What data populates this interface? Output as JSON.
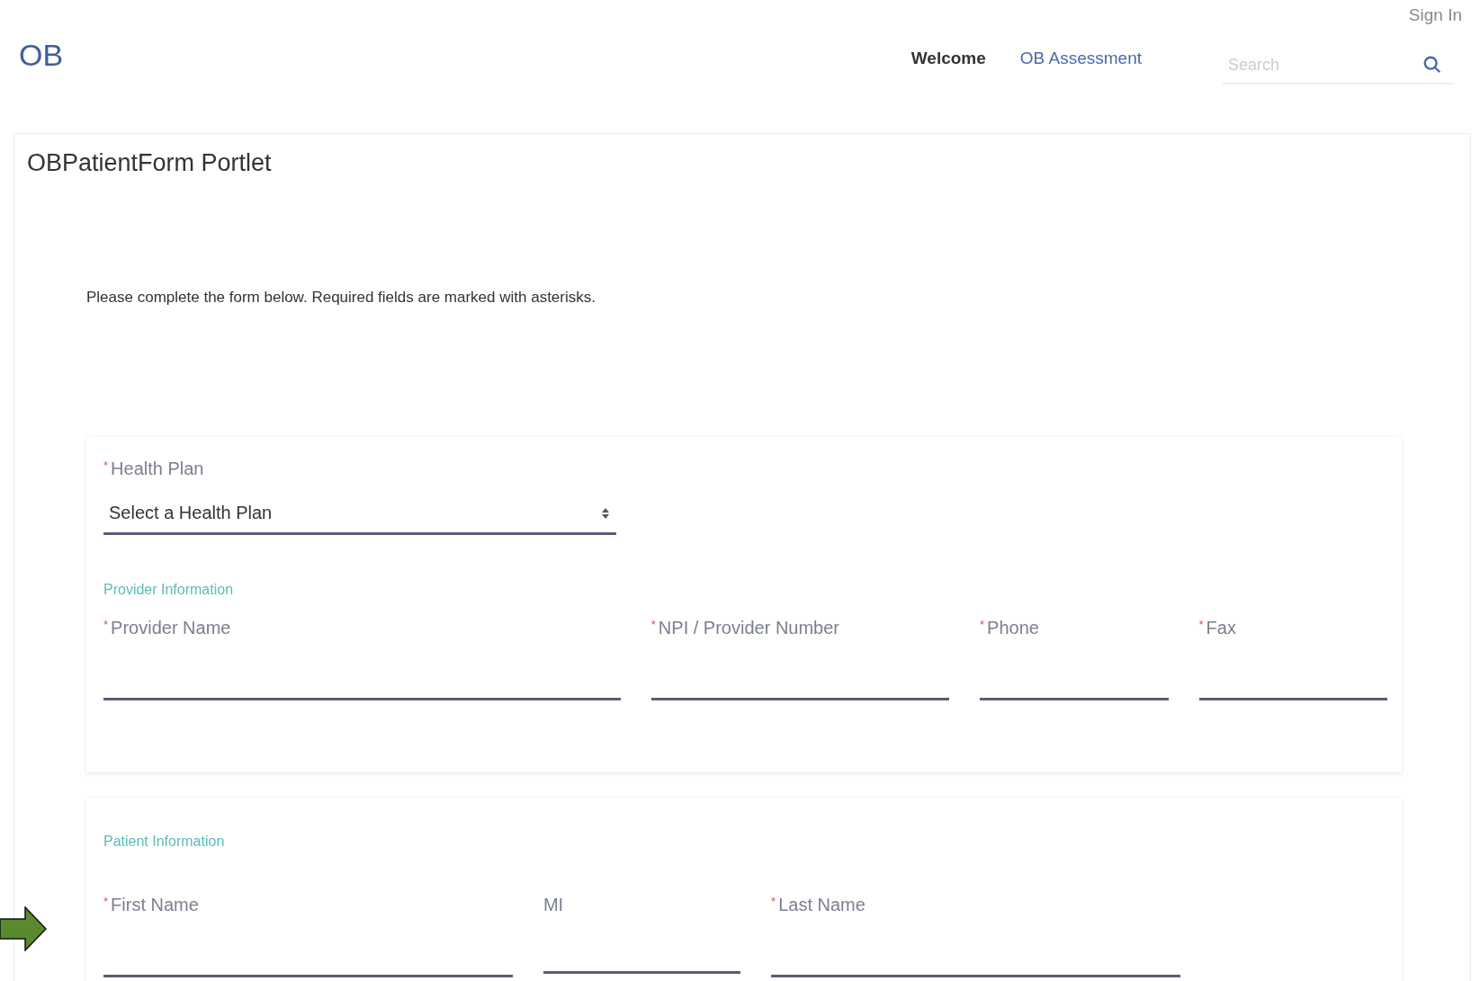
{
  "header": {
    "logo": "OB",
    "sign_in": "Sign In",
    "nav": [
      {
        "label": "Welcome",
        "selected": true
      },
      {
        "label": "OB Assessment",
        "selected": false
      }
    ],
    "search": {
      "placeholder": "Search"
    }
  },
  "portlet": {
    "title": "OBPatientForm Portlet",
    "intro": "Please complete the form below. Required fields are marked with asterisks.",
    "health_plan": {
      "mark": "*",
      "label": "Health Plan",
      "value": "Select a Health Plan"
    },
    "sections": [
      {
        "title": "Provider Information",
        "fields": [
          {
            "mark": "*",
            "label": "Provider Name"
          },
          {
            "mark": "*",
            "label": "NPI / Provider Number"
          },
          {
            "mark": "*",
            "label": "Phone"
          },
          {
            "mark": "*",
            "label": "Fax"
          }
        ]
      },
      {
        "title": "Patient Information",
        "fields": [
          {
            "mark": "*",
            "label": "First Name"
          },
          {
            "label": "MI"
          },
          {
            "mark": "*",
            "label": "Last Name"
          }
        ]
      }
    ]
  }
}
